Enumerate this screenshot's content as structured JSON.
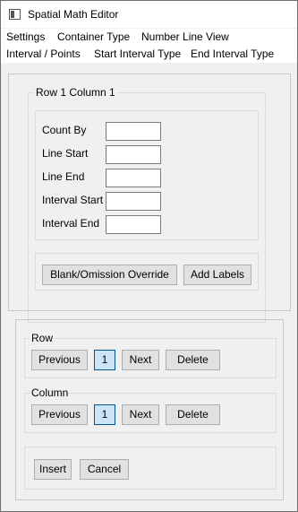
{
  "window": {
    "title": "Spatial Math Editor"
  },
  "menu": {
    "row1": [
      "Settings",
      "Container Type",
      "Number Line View"
    ],
    "row2": [
      "Interval / Points",
      "Start Interval Type",
      "End Interval Type"
    ]
  },
  "cell_group": {
    "legend": "Row 1 Column 1",
    "fields": {
      "count_by": {
        "label": "Count By",
        "value": ""
      },
      "line_start": {
        "label": "Line Start",
        "value": ""
      },
      "line_end": {
        "label": "Line End",
        "value": ""
      },
      "interval_start": {
        "label": "Interval Start",
        "value": ""
      },
      "interval_end": {
        "label": "Interval End",
        "value": ""
      }
    },
    "blank_override_label": "Blank/Omission Override",
    "add_labels_label": "Add Labels"
  },
  "row_group": {
    "legend": "Row",
    "previous_label": "Previous",
    "current": "1",
    "next_label": "Next",
    "delete_label": "Delete"
  },
  "column_group": {
    "legend": "Column",
    "previous_label": "Previous",
    "current": "1",
    "next_label": "Next",
    "delete_label": "Delete"
  },
  "actions": {
    "insert_label": "Insert",
    "cancel_label": "Cancel"
  }
}
